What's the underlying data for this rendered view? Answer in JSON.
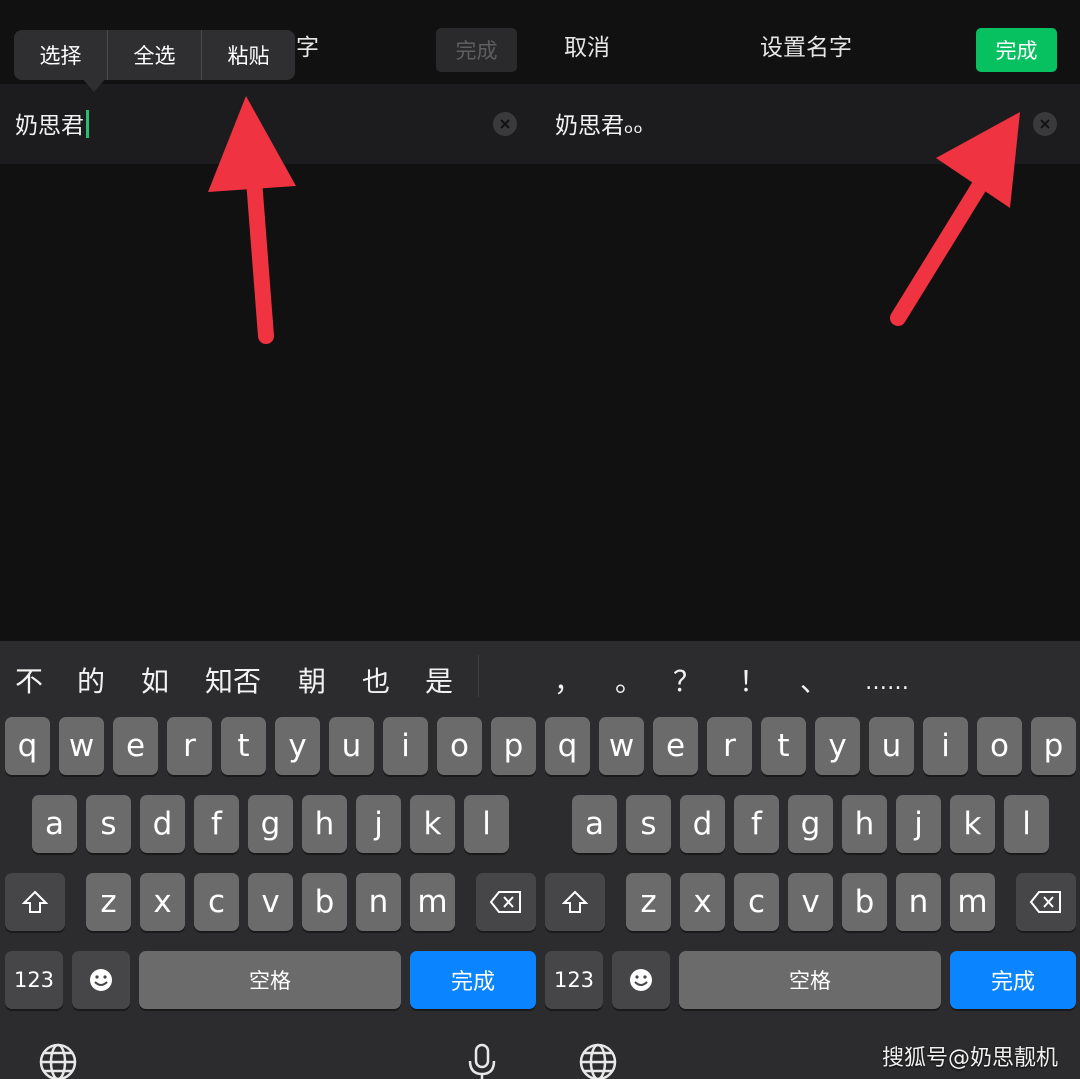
{
  "left": {
    "title_fragment": "字",
    "done_label": "完成",
    "input_value": "奶思君",
    "popup": [
      "选择",
      "全选",
      "粘贴"
    ],
    "candidates": [
      "不",
      "的",
      "如",
      "知否",
      "朝",
      "也",
      "是"
    ]
  },
  "right": {
    "cancel_label": "取消",
    "title": "设置名字",
    "done_label": "完成",
    "input_value": "奶思君ₒₒ",
    "punctuation": [
      "，",
      "。",
      "？",
      "！",
      "、",
      "……"
    ]
  },
  "keyboard": {
    "row1": [
      "q",
      "w",
      "e",
      "r",
      "t",
      "y",
      "u",
      "i",
      "o",
      "p"
    ],
    "row2": [
      "a",
      "s",
      "d",
      "f",
      "g",
      "h",
      "j",
      "k",
      "l"
    ],
    "row3": [
      "z",
      "x",
      "c",
      "v",
      "b",
      "n",
      "m"
    ],
    "num_label": "123",
    "space_label": "空格",
    "done_label": "完成"
  },
  "watermark": "搜狐号@奶思靓机",
  "colors": {
    "accent_green": "#07c160",
    "keyboard_blue": "#0a84ff",
    "arrow_red": "#ef3340"
  },
  "icons": [
    "shift-icon",
    "backspace-icon",
    "emoji-icon",
    "globe-icon",
    "microphone-icon",
    "clear-icon",
    "chevron-down-icon"
  ]
}
